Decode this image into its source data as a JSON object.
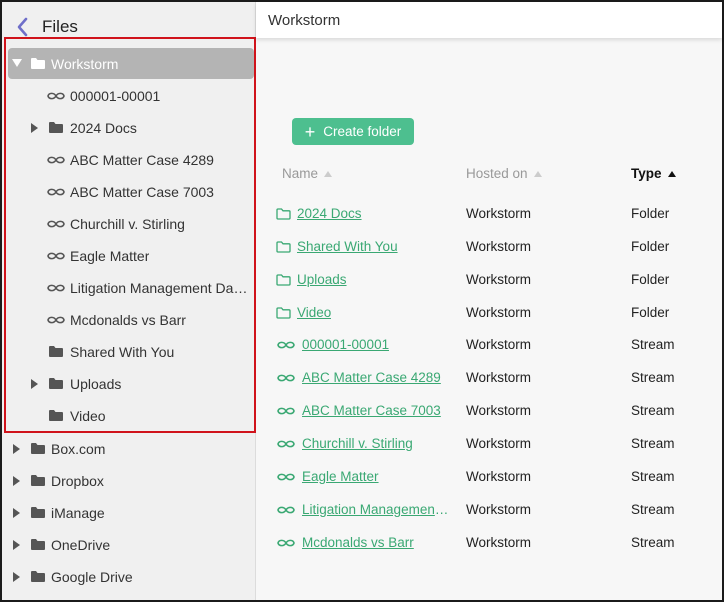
{
  "sidebar": {
    "title": "Files",
    "tree": [
      {
        "label": "Workstorm",
        "icon": "folder-icon",
        "arrow": "expanded",
        "selected": true
      },
      {
        "label": "000001-00001",
        "icon": "stream-icon"
      },
      {
        "label": "2024 Docs",
        "icon": "folder-icon",
        "arrow": "collapsed"
      },
      {
        "label": "ABC Matter Case 4289",
        "icon": "stream-icon"
      },
      {
        "label": "ABC Matter Case 7003",
        "icon": "stream-icon"
      },
      {
        "label": "Churchill v. Stirling",
        "icon": "stream-icon"
      },
      {
        "label": "Eagle Matter",
        "icon": "stream-icon"
      },
      {
        "label": "Litigation Management Dat...",
        "icon": "stream-icon"
      },
      {
        "label": "Mcdonalds vs Barr",
        "icon": "stream-icon"
      },
      {
        "label": "Shared With You",
        "icon": "folder-icon"
      },
      {
        "label": "Uploads",
        "icon": "folder-icon",
        "arrow": "collapsed"
      },
      {
        "label": "Video",
        "icon": "folder-icon"
      },
      {
        "label": "Box.com",
        "icon": "folder-icon",
        "arrow": "collapsed"
      },
      {
        "label": "Dropbox",
        "icon": "folder-icon",
        "arrow": "collapsed"
      },
      {
        "label": "iManage",
        "icon": "folder-icon",
        "arrow": "collapsed"
      },
      {
        "label": "OneDrive",
        "icon": "folder-icon",
        "arrow": "collapsed"
      },
      {
        "label": "Google Drive",
        "icon": "folder-icon",
        "arrow": "collapsed"
      }
    ]
  },
  "main": {
    "title": "Workstorm",
    "create_folder_label": "Create folder",
    "columns": {
      "name": "Name",
      "hosted_on": "Hosted on",
      "type": "Type"
    },
    "rows": [
      {
        "name": "2024 Docs",
        "hosted_on": "Workstorm",
        "type": "Folder",
        "icon": "folder-outline-icon"
      },
      {
        "name": "Shared With You",
        "hosted_on": "Workstorm",
        "type": "Folder",
        "icon": "folder-outline-icon"
      },
      {
        "name": "Uploads",
        "hosted_on": "Workstorm",
        "type": "Folder",
        "icon": "folder-outline-icon"
      },
      {
        "name": "Video",
        "hosted_on": "Workstorm",
        "type": "Folder",
        "icon": "folder-outline-icon"
      },
      {
        "name": "000001-00001",
        "hosted_on": "Workstorm",
        "type": "Stream",
        "icon": "stream-icon"
      },
      {
        "name": "ABC Matter Case 4289",
        "hosted_on": "Workstorm",
        "type": "Stream",
        "icon": "stream-icon"
      },
      {
        "name": "ABC Matter Case 7003",
        "hosted_on": "Workstorm",
        "type": "Stream",
        "icon": "stream-icon"
      },
      {
        "name": "Churchill v. Stirling",
        "hosted_on": "Workstorm",
        "type": "Stream",
        "icon": "stream-icon"
      },
      {
        "name": "Eagle Matter",
        "hosted_on": "Workstorm",
        "type": "Stream",
        "icon": "stream-icon"
      },
      {
        "name": "Litigation Management…",
        "hosted_on": "Workstorm",
        "type": "Stream",
        "icon": "stream-icon"
      },
      {
        "name": "Mcdonalds vs Barr",
        "hosted_on": "Workstorm",
        "type": "Stream",
        "icon": "stream-icon"
      }
    ]
  },
  "colors": {
    "accent": "#4dbf8f",
    "link": "#3aa873",
    "selected_bg": "#b4b4b4",
    "highlight_border": "#d0131b",
    "back_icon": "#6f6fc9"
  }
}
